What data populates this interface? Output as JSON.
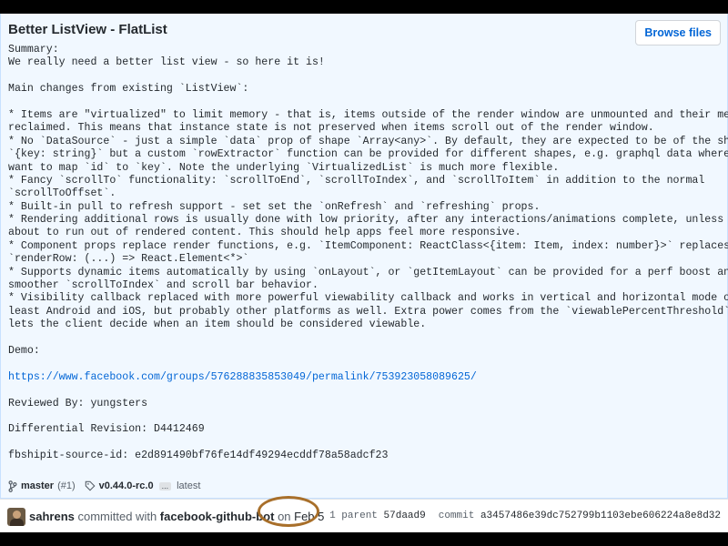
{
  "commit": {
    "title": "Better ListView - FlatList",
    "browse_label": "Browse files",
    "description_lines": [
      "Summary:",
      "We really need a better list view - so here it is!",
      "",
      "Main changes from existing `ListView`:",
      "",
      "* Items are \"virtualized\" to limit memory - that is, items outside of the render window are unmounted and their memory is",
      "reclaimed. This means that instance state is not preserved when items scroll out of the render window.",
      "* No `DataSource` - just a simple `data` prop of shape `Array<any>`. By default, they are expected to be of the shape",
      "`{key: string}` but a custom `rowExtractor` function can be provided for different shapes, e.g. graphql data where you",
      "want to map `id` to `key`. Note the underlying `VirtualizedList` is much more flexible.",
      "* Fancy `scrollTo` functionality: `scrollToEnd`, `scrollToIndex`, and `scrollToItem` in addition to the normal",
      "`scrollToOffset`.",
      "* Built-in pull to refresh support - set set the `onRefresh` and `refreshing` props.",
      "* Rendering additional rows is usually done with low priority, after any interactions/animations complete, unless we're",
      "about to run out of rendered content. This should help apps feel more responsive.",
      "* Component props replace render functions, e.g. `ItemComponent: ReactClass<{item: Item, index: number}>` replaces",
      "`renderRow: (...) => React.Element<*>`",
      "* Supports dynamic items automatically by using `onLayout`, or `getItemLayout` can be provided for a perf boost and",
      "smoother `scrollToIndex` and scroll bar behavior.",
      "* Visibility callback replaced with more powerful viewability callback and works in vertical and horizontal mode on at",
      "least Android and iOS, but probably other platforms as well. Extra power comes from the `viewablePercentThreshold` that",
      "lets the client decide when an item should be considered viewable.",
      "",
      "Demo:",
      "",
      "https://www.facebook.com/groups/576288835853049/permalink/753923058089625/",
      "",
      "Reviewed By: yungsters",
      "",
      "Differential Revision: D4412469",
      "",
      "fbshipit-source-id: e2d891490bf76fe14df49294ecddf78a58adcf23"
    ],
    "branch": "master",
    "pr": "(#1)",
    "tag": "v0.44.0-rc.0",
    "ellipsis": "...",
    "latest": "latest"
  },
  "footer": {
    "author": "sahrens",
    "committed_with": " committed with ",
    "committer": "facebook-github-bot",
    "on": " on ",
    "date": "Feb 5",
    "parent_label": "1 parent",
    "parent_sha": "57daad9",
    "commit_label": "commit",
    "commit_sha": "a3457486e39dc752799b1103ebe606224a8e8d32"
  },
  "colors": {
    "accent": "#0366d6",
    "box_bg": "#f1f8ff",
    "annotation": "#a86f2a"
  },
  "icons": {
    "branch": "git-branch-icon",
    "tag": "tag-icon"
  }
}
